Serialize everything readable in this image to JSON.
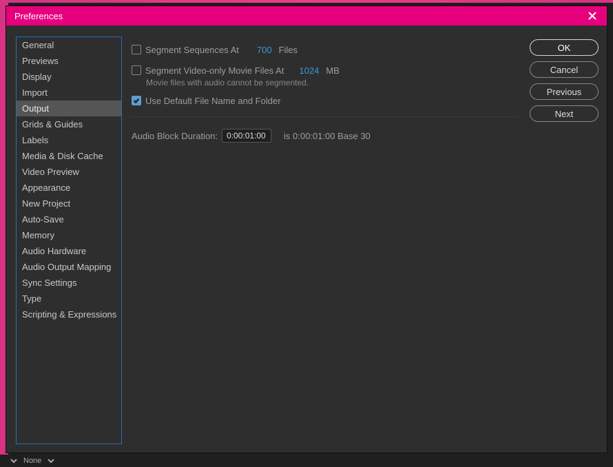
{
  "titlebar": {
    "title": "Preferences"
  },
  "sidebar": {
    "items": [
      "General",
      "Previews",
      "Display",
      "Import",
      "Output",
      "Grids & Guides",
      "Labels",
      "Media & Disk Cache",
      "Video Preview",
      "Appearance",
      "New Project",
      "Auto-Save",
      "Memory",
      "Audio Hardware",
      "Audio Output Mapping",
      "Sync Settings",
      "Type",
      "Scripting & Expressions"
    ],
    "selected_index": 4
  },
  "main": {
    "segment_sequences": {
      "label": "Segment Sequences At",
      "checked": false,
      "value": "700",
      "unit": "Files"
    },
    "segment_video": {
      "label": "Segment Video-only Movie Files At",
      "checked": false,
      "value": "1024",
      "unit": "MB",
      "note": "Movie files with audio cannot be segmented."
    },
    "use_default": {
      "label": "Use Default File Name and Folder",
      "checked": true
    },
    "audio_block": {
      "label": "Audio Block Duration:",
      "value": "0:00:01:00",
      "hint": "is 0:00:01:00  Base 30"
    }
  },
  "buttons": {
    "ok": "OK",
    "cancel": "Cancel",
    "previous": "Previous",
    "next": "Next"
  },
  "bottom": {
    "none_label": "None"
  }
}
